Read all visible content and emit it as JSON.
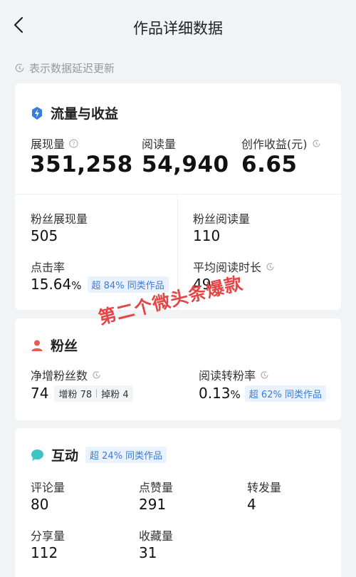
{
  "header": {
    "title": "作品详细数据"
  },
  "notice": {
    "text": "表示数据延迟更新"
  },
  "traffic": {
    "title": "流量与收益",
    "impressions_label": "展现量",
    "impressions_value": "351,258",
    "reads_label": "阅读量",
    "reads_value": "54,940",
    "earnings_label": "创作收益(元)",
    "earnings_value": "6.65",
    "fan_impressions_label": "粉丝展现量",
    "fan_impressions_value": "505",
    "fan_reads_label": "粉丝阅读量",
    "fan_reads_value": "110",
    "ctr_label": "点击率",
    "ctr_number": "15.64",
    "ctr_unit": "%",
    "ctr_badge": "超 84% 同类作品",
    "avg_time_label": "平均阅读时长",
    "avg_time_value": "49"
  },
  "fans": {
    "title": "粉丝",
    "net_label": "净增粉丝数",
    "net_value": "74",
    "gain_label": "增粉",
    "gain_value": "78",
    "loss_label": "掉粉",
    "loss_value": "4",
    "conversion_label": "阅读转粉率",
    "conversion_number": "0.13",
    "conversion_unit": "%",
    "conversion_badge": "超 62% 同类作品"
  },
  "interaction": {
    "title": "互动",
    "badge": "超 24% 同类作品",
    "comments_label": "评论量",
    "comments_value": "80",
    "likes_label": "点赞量",
    "likes_value": "291",
    "reposts_label": "转发量",
    "reposts_value": "4",
    "shares_label": "分享量",
    "shares_value": "112",
    "favorites_label": "收藏量",
    "favorites_value": "31"
  },
  "watermark": {
    "text": "第二个微头条爆款"
  },
  "colors": {
    "accent_blue": "#3b7bd9",
    "fans_icon": "#e85b4e",
    "interaction_icon": "#3fc3c6",
    "watermark": "#e64545"
  }
}
